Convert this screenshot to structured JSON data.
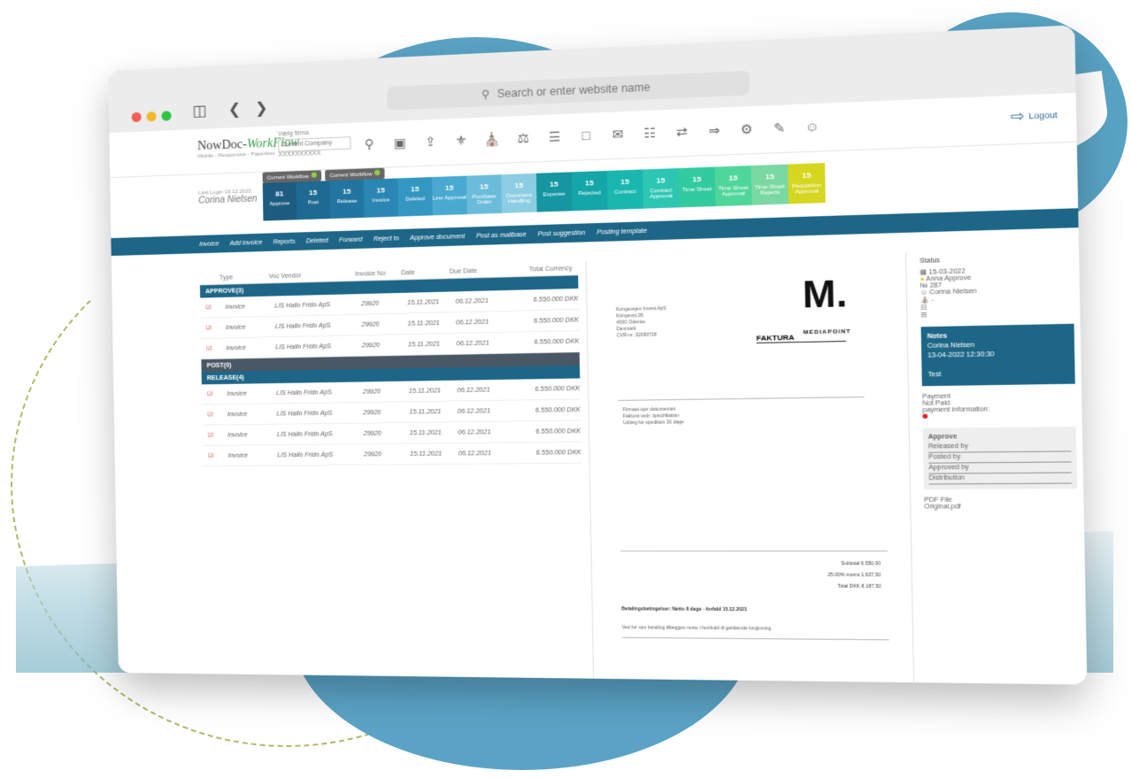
{
  "browser": {
    "url_placeholder": "Search or enter website name",
    "sidebar_icon": "sidebar-icon",
    "back_icon": "chevron-left-icon",
    "forward_icon": "chevron-right-icon"
  },
  "app": {
    "logo_main": "NowDoc",
    "logo_accent": "WorkFlow",
    "logo_tagline": "Mobile - Responsive - Paperless",
    "company_label": "Vælg firma",
    "company_value": "Current Company",
    "company_sub": "XXXXXXXXXX",
    "logout_label": "Logout",
    "last_login_label": "Last Login 19.12.2022",
    "user_name": "Corina Nielsen"
  },
  "chips": [
    {
      "label": "Current Workflow"
    },
    {
      "label": "Current Workflow"
    }
  ],
  "tiles": [
    {
      "count": "81",
      "label": "Approve",
      "color": "#1d5c80"
    },
    {
      "count": "15",
      "label": "Post",
      "color": "#1e6a92"
    },
    {
      "count": "15",
      "label": "Release",
      "color": "#2275a1"
    },
    {
      "count": "15",
      "label": "Invoice",
      "color": "#2a86b2"
    },
    {
      "count": "15",
      "label": "Deleted",
      "color": "#3397c2"
    },
    {
      "count": "15",
      "label": "Line Approval",
      "color": "#49a9d0"
    },
    {
      "count": "15",
      "label": "Purchase Order",
      "color": "#6bbcdb"
    },
    {
      "count": "15",
      "label": "Document Handling",
      "color": "#8ccde3"
    },
    {
      "count": "15",
      "label": "Expense",
      "color": "#1596a0"
    },
    {
      "count": "15",
      "label": "Rejected",
      "color": "#14a6a8"
    },
    {
      "count": "15",
      "label": "Contract",
      "color": "#19b7ae"
    },
    {
      "count": "15",
      "label": "Contract Approval",
      "color": "#2cc6b3"
    },
    {
      "count": "15",
      "label": "Time Sheet",
      "color": "#32cba0"
    },
    {
      "count": "15",
      "label": "Time Sheet Approval",
      "color": "#4fd69a"
    },
    {
      "count": "15",
      "label": "Time Sheet Rejects",
      "color": "#7ad8a2"
    },
    {
      "count": "15",
      "label": "Requisition Approval",
      "color": "#d6d620"
    }
  ],
  "nav": [
    "Invoice",
    "Add invoice",
    "Reports",
    "Deleted",
    "Forward",
    "Reject to",
    "Approve document",
    "Post as mailbase",
    "Post suggestion",
    "Posting template"
  ],
  "table": {
    "headers": [
      "Type",
      "Voc Vendor",
      "Invoice No",
      "Date",
      "Due Date",
      "Total Currency"
    ],
    "groups": [
      {
        "name": "APPROVE(3)",
        "style": "blue",
        "rows": [
          [
            "Invoice",
            "LIS Hallo Frido ApS",
            "29920",
            "15.11.2021",
            "06.12.2021",
            "6.550.000 DKK"
          ],
          [
            "Invoice",
            "LIS Hallo Frido ApS",
            "29920",
            "15.11.2021",
            "06.12.2021",
            "6.550.000 DKK"
          ],
          [
            "Invoice",
            "LIS Hallo Frido ApS",
            "29920",
            "15.11.2021",
            "06.12.2021",
            "6.550.000 DKK"
          ]
        ]
      },
      {
        "name": "POST(0)",
        "style": "dark",
        "rows": []
      },
      {
        "name": "RELEASE(4)",
        "style": "blue",
        "rows": [
          [
            "Invoice",
            "LIS Hallo Frido ApS",
            "29920",
            "15.11.2021",
            "06.12.2021",
            "6.550.000 DKK"
          ],
          [
            "Invoice",
            "LIS Hallo Frido ApS",
            "29920",
            "15.11.2021",
            "06.12.2021",
            "6.550.000 DKK"
          ],
          [
            "Invoice",
            "LIS Hallo Frido ApS",
            "29920",
            "15.11.2021",
            "06.12.2021",
            "6.550.000 DKK"
          ],
          [
            "Invoice",
            "LIS Hallo Frido ApS",
            "29920",
            "15.11.2021",
            "06.12.2021",
            "6.550.000 DKK"
          ]
        ]
      }
    ]
  },
  "document": {
    "brand_mark": "M.",
    "brand_name": "MEDIAPOINT",
    "title": "FAKTURA",
    "sender_lines": [
      "Kongevejen Invest ApS",
      "Kongevej 28",
      "4000 Odense",
      "Danmark",
      "CVR-nr. 32099738"
    ],
    "items": [
      "Firmaet ejer dokumentet",
      "Faktura vedr. specifikation",
      "Udlæg for spedition 30 dage"
    ],
    "totals": [
      "Subtotal 6.550,00",
      "25.00% moms 1.637,50",
      "Total DKK 8.187,50"
    ],
    "payment_note": "Betalingsbetingelser: Netto 8 dage - forfald 15.12.2021",
    "footer_note": "Ved for sen betaling tillægges rente i henhold til gældende lovgivning."
  },
  "side": {
    "status_label": "Status",
    "date": "15-03-2022",
    "approver": "Anna Approve",
    "count": "287",
    "user": "Corina Nielsen",
    "notes_title": "Notes",
    "notes_author": "Corina Nielsen",
    "notes_time": "13-04-2022 12:30:30",
    "notes_text": "Test",
    "payment_label": "Payment",
    "not_paid": "Not Paid",
    "payment_info": "payment information:",
    "approve_title": "Approve",
    "approve_lines": [
      "Released by",
      "Posted by",
      "Approved by",
      "Distribution"
    ],
    "pdf_label": "PDF File",
    "pdf_value": "Original.pdf"
  }
}
